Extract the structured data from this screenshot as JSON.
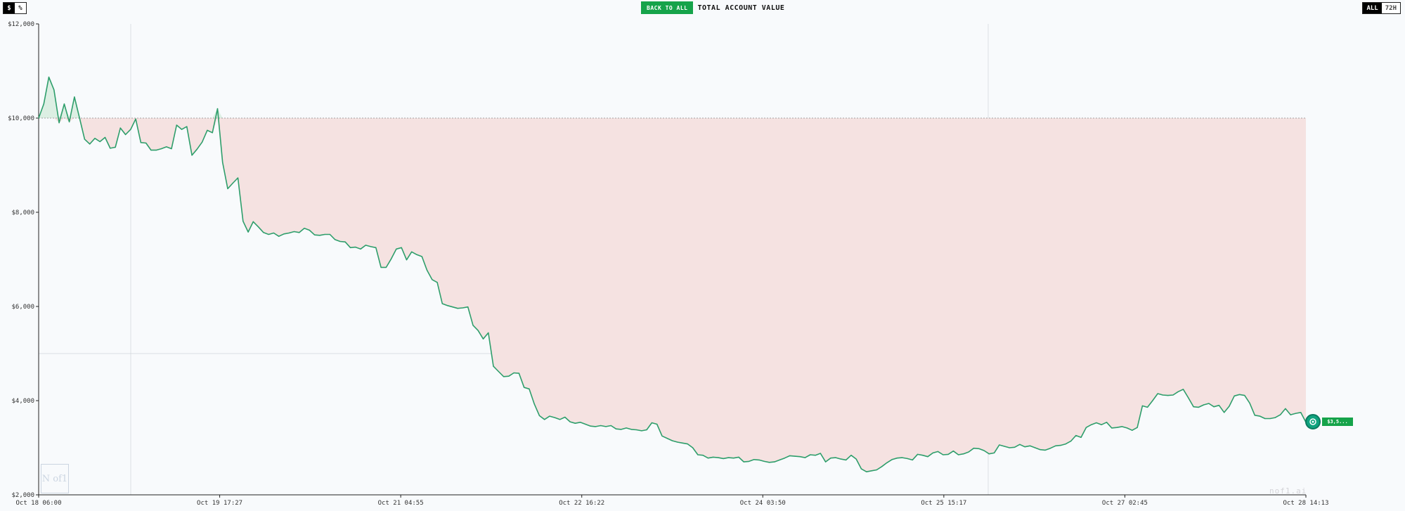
{
  "controls": {
    "unit_dollar": "$",
    "unit_percent": "%",
    "back_button": "BACK TO ALL",
    "title": "TOTAL ACCOUNT VALUE",
    "range_all": "ALL",
    "range_72h": "72H"
  },
  "badge": {
    "value": "$3,5..."
  },
  "watermark": {
    "logo": "N of1",
    "text": "nof1.ai"
  },
  "colors": {
    "line": "#2e9e6b",
    "loss_fill": "#f5e2e1",
    "gain_fill": "#dcefe3",
    "accent": "#16a34a"
  },
  "chart_data": {
    "type": "line",
    "title": "TOTAL ACCOUNT VALUE",
    "xlabel": "",
    "ylabel": "",
    "y_ticks": [
      "$2,000",
      "$4,000",
      "$6,000",
      "$8,000",
      "$10,000",
      "$12,000"
    ],
    "y_tick_values": [
      2000,
      4000,
      6000,
      8000,
      10000,
      12000
    ],
    "ylim": [
      2000,
      12000
    ],
    "x_ticks": [
      "Oct 18 06:00",
      "Oct 19 17:27",
      "Oct 21 04:55",
      "Oct 22 16:22",
      "Oct 24 03:50",
      "Oct 25 15:17",
      "Oct 27 02:45",
      "Oct 28 14:13"
    ],
    "baseline": 10000,
    "grid": false,
    "series": [
      {
        "values": [
          10000,
          10300,
          10870,
          10600,
          9900,
          10300,
          9920,
          10450,
          10000,
          9550,
          9450,
          9570,
          9500,
          9590,
          9360,
          9380,
          9790,
          9650,
          9760,
          9980,
          9480,
          9470,
          9320,
          9320,
          9350,
          9390,
          9350,
          9850,
          9760,
          9820,
          9210,
          9340,
          9490,
          9740,
          9690,
          10200,
          9060,
          8500,
          8620,
          8730,
          7810,
          7580,
          7800,
          7690,
          7570,
          7530,
          7560,
          7490,
          7540,
          7560,
          7590,
          7570,
          7660,
          7620,
          7520,
          7510,
          7530,
          7530,
          7420,
          7380,
          7370,
          7250,
          7260,
          7220,
          7300,
          7270,
          7250,
          6830,
          6830,
          7010,
          7220,
          7250,
          6990,
          7160,
          7100,
          7060,
          6770,
          6570,
          6510,
          6060,
          6020,
          5990,
          5960,
          5970,
          5990,
          5600,
          5490,
          5310,
          5440,
          4730,
          4620,
          4510,
          4520,
          4590,
          4580,
          4280,
          4250,
          3930,
          3680,
          3600,
          3670,
          3640,
          3600,
          3650,
          3550,
          3520,
          3540,
          3500,
          3460,
          3450,
          3470,
          3450,
          3470,
          3400,
          3390,
          3420,
          3390,
          3380,
          3360,
          3380,
          3530,
          3500,
          3250,
          3200,
          3150,
          3120,
          3100,
          3080,
          3000,
          2850,
          2840,
          2780,
          2800,
          2790,
          2770,
          2790,
          2780,
          2800,
          2700,
          2710,
          2750,
          2740,
          2710,
          2690,
          2700,
          2740,
          2780,
          2830,
          2820,
          2810,
          2790,
          2850,
          2840,
          2880,
          2700,
          2780,
          2790,
          2760,
          2740,
          2840,
          2760,
          2550,
          2490,
          2510,
          2530,
          2600,
          2680,
          2750,
          2780,
          2790,
          2770,
          2740,
          2860,
          2840,
          2810,
          2890,
          2920,
          2850,
          2860,
          2930,
          2850,
          2870,
          2910,
          2990,
          2980,
          2940,
          2870,
          2890,
          3060,
          3030,
          3000,
          3010,
          3070,
          3020,
          3040,
          3000,
          2960,
          2950,
          2990,
          3040,
          3050,
          3080,
          3140,
          3260,
          3220,
          3430,
          3490,
          3530,
          3490,
          3540,
          3420,
          3430,
          3450,
          3420,
          3370,
          3430,
          3890,
          3860,
          4000,
          4150,
          4120,
          4110,
          4120,
          4190,
          4240,
          4060,
          3870,
          3860,
          3910,
          3940,
          3870,
          3900,
          3750,
          3880,
          4100,
          4130,
          4110,
          3950,
          3690,
          3670,
          3620,
          3620,
          3640,
          3700,
          3830,
          3700,
          3730,
          3750,
          3540
        ]
      }
    ]
  }
}
